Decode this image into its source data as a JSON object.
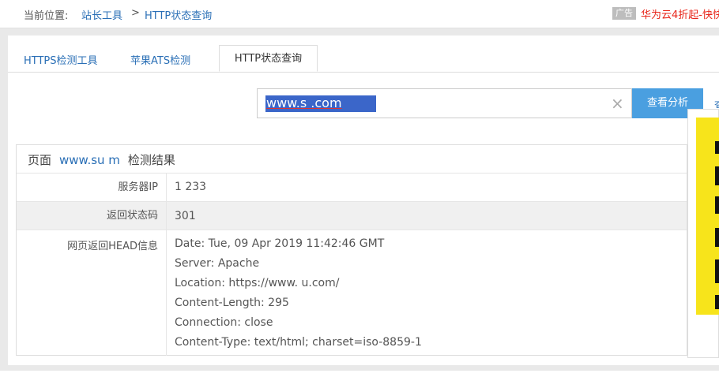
{
  "breadcrumb": {
    "label": "当前位置:",
    "link1": "站长工具",
    "separator": ">",
    "link2": "HTTP状态查询"
  },
  "ad": {
    "badge": "广告",
    "text": "华为云4折起-快快"
  },
  "tabs": [
    {
      "label": "HTTPS检测工具"
    },
    {
      "label": "苹果ATS检测"
    },
    {
      "label": "HTTP状态查询"
    }
  ],
  "search": {
    "value": "www.s        .com",
    "selected_text": "www.s           .com",
    "clear_icon": "×",
    "button_label": "查看分析",
    "right_link": "查"
  },
  "result": {
    "title_prefix": "页面",
    "title_host": "www.su          m",
    "title_suffix": "检测结果",
    "rows": {
      "server_ip": {
        "label": "服务器IP",
        "value": "1              233"
      },
      "status_code": {
        "label": "返回状态码",
        "value": "301"
      },
      "head_info": {
        "label": "网页返回HEAD信息",
        "lines": [
          "Date: Tue, 09 Apr 2019 11:42:46 GMT",
          "Server: Apache",
          "Location: https://www.          u.com/",
          "Content-Length: 295",
          "Connection: close",
          "Content-Type: text/html; charset=iso-8859-1"
        ]
      }
    }
  },
  "colors": {
    "link": "#2a6fb6",
    "button": "#4a9fe0",
    "ad_red": "#e8251a",
    "ad_yellow": "#f7e41b"
  }
}
